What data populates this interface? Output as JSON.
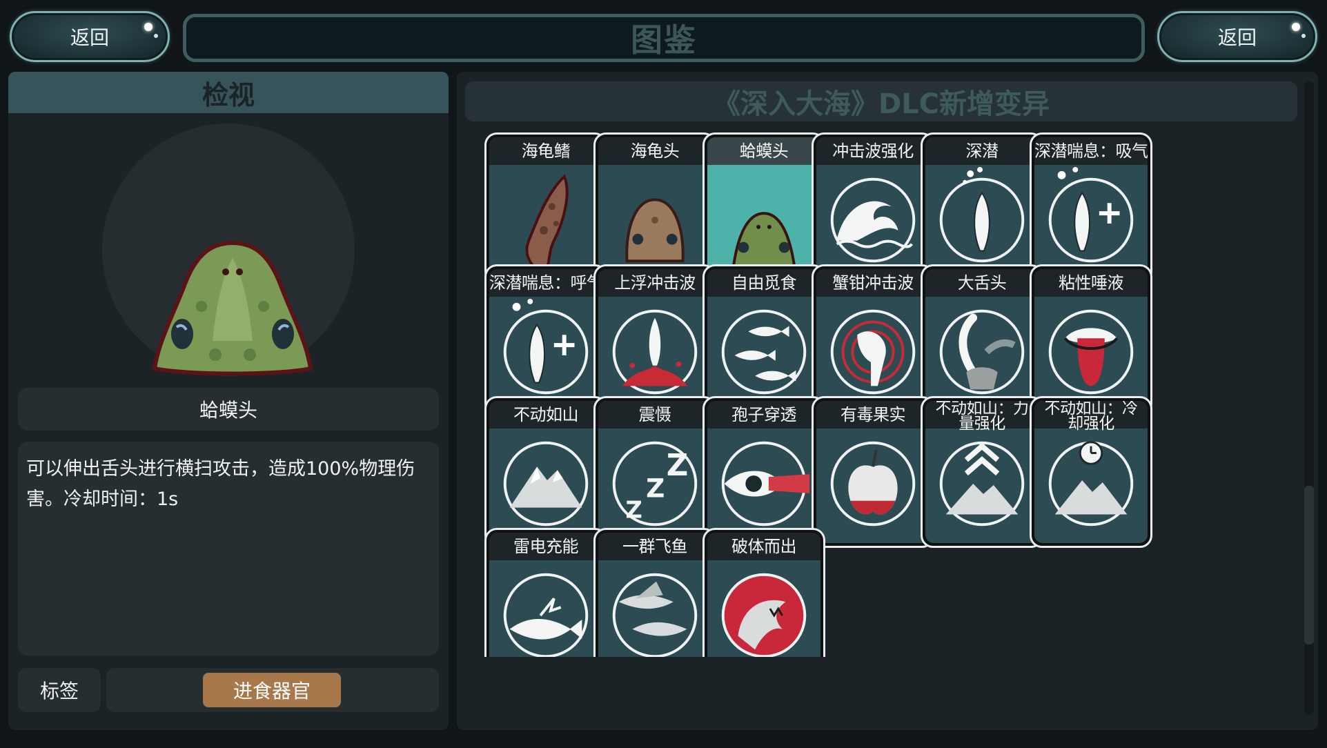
{
  "header": {
    "back_left": "返回",
    "title": "图鉴",
    "back_right": "返回"
  },
  "inspect": {
    "header": "检视",
    "name": "蛤蟆头",
    "description": "可以伸出舌头进行横扫攻击，造成100%物理伤害。冷却时间：1s",
    "tag_label": "标签",
    "tag_value": "进食器官"
  },
  "catalog": {
    "header": "《深入大海》DLC新增变异",
    "items": [
      {
        "label": "海龟鳍",
        "icon": "turtle-fin-icon"
      },
      {
        "label": "海龟头",
        "icon": "turtle-head-icon"
      },
      {
        "label": "蛤蟆头",
        "icon": "toad-head-icon",
        "selected": true
      },
      {
        "label": "冲击波强化",
        "icon": "wave-icon"
      },
      {
        "label": "深潜",
        "icon": "diving-fish-icon"
      },
      {
        "label": "深潜喘息：吸气",
        "icon": "fish-plus-icon"
      },
      {
        "label": "深潜喘息：呼气",
        "icon": "fish-plus-icon"
      },
      {
        "label": "上浮冲击波",
        "icon": "fish-splash-icon"
      },
      {
        "label": "自由觅食",
        "icon": "school-of-fish-icon"
      },
      {
        "label": "蟹钳冲击波",
        "icon": "crab-claw-icon"
      },
      {
        "label": "大舌头",
        "icon": "big-tongue-icon"
      },
      {
        "label": "粘性唾液",
        "icon": "mouth-tongue-icon"
      },
      {
        "label": "不动如山",
        "icon": "mountain-icon"
      },
      {
        "label": "震慑",
        "icon": "zzz-icon"
      },
      {
        "label": "孢子穿透",
        "icon": "eye-beam-icon"
      },
      {
        "label": "有毒果实",
        "icon": "poison-apple-icon"
      },
      {
        "label": "不动如山：力量强化",
        "icon": "mountain-chevron-icon"
      },
      {
        "label": "不动如山：冷却强化",
        "icon": "mountain-clock-icon"
      },
      {
        "label": "雷电充能",
        "icon": "fish-lightning-icon"
      },
      {
        "label": "一群飞鱼",
        "icon": "flying-fish-icon"
      },
      {
        "label": "破体而出",
        "icon": "shark-burst-icon"
      }
    ]
  }
}
